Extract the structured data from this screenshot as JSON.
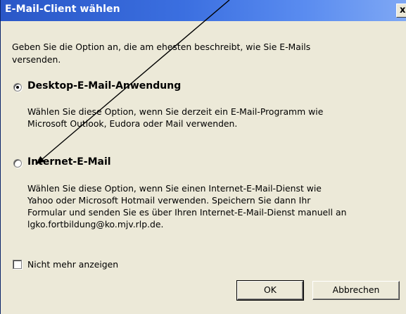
{
  "dialog": {
    "title": "E-Mail-Client wählen",
    "close_glyph": "x",
    "intro_line1": "Geben Sie die Option an, die am ehesten beschreibt, wie Sie E-Mails",
    "intro_line2": "versenden."
  },
  "options": [
    {
      "label": "Desktop-E-Mail-Anwendung",
      "selected": true,
      "desc_line1": "Wählen Sie diese Option, wenn Sie derzeit ein E-Mail-Programm wie",
      "desc_line2": "Microsoft Outlook, Eudora oder Mail verwenden."
    },
    {
      "label": "Internet-E-Mail",
      "selected": false,
      "desc_line1": "Wählen Sie diese Option, wenn Sie einen Internet-E-Mail-Dienst wie",
      "desc_line2": "Yahoo oder Microsoft Hotmail verwenden. Speichern Sie dann Ihr",
      "desc_line3": "Formular und senden Sie es über Ihren Internet-E-Mail-Dienst manuell an",
      "desc_line4": "lgko.fortbildung@ko.mjv.rlp.de."
    }
  ],
  "checkbox": {
    "label": "Nicht mehr anzeigen",
    "checked": false
  },
  "buttons": {
    "ok": "OK",
    "cancel": "Abbrechen"
  },
  "colors": {
    "titlebar_start": "#2a57c7",
    "titlebar_end": "#7fa8f4",
    "dialog_bg": "#ece9d8"
  }
}
